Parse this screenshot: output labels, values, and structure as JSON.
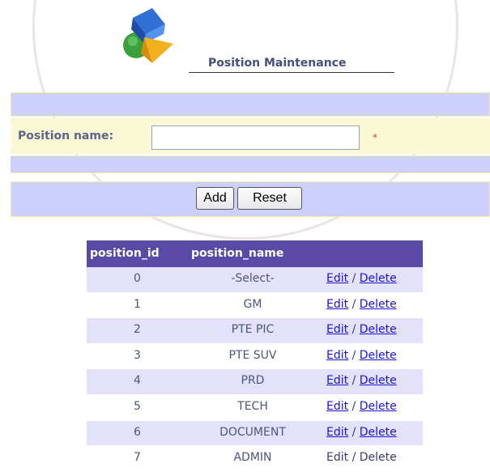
{
  "page": {
    "title": "Position Maintenance"
  },
  "form": {
    "label": "Position name:",
    "input_value": "",
    "required_mark": "*",
    "add_label": "Add",
    "reset_label": "Reset"
  },
  "table": {
    "headers": [
      "position_id",
      "position_name"
    ],
    "edit_label": "Edit",
    "separator": "/",
    "delete_label": "Delete",
    "rows": [
      {
        "id": "0",
        "name": "-Select-"
      },
      {
        "id": "1",
        "name": "GM"
      },
      {
        "id": "2",
        "name": "PTE PIC"
      },
      {
        "id": "3",
        "name": "PTE SUV"
      },
      {
        "id": "4",
        "name": "PRD"
      },
      {
        "id": "5",
        "name": "TECH"
      },
      {
        "id": "6",
        "name": "DOCUMENT"
      },
      {
        "id": "7",
        "name": "ADMIN"
      }
    ]
  },
  "colors": {
    "header_bg": "#5a4aa6",
    "band_blue": "#cdd0fb",
    "band_yellow": "#fbf8d6",
    "link": "#1a12d6"
  },
  "icons": [
    "shapes-logo-icon"
  ]
}
